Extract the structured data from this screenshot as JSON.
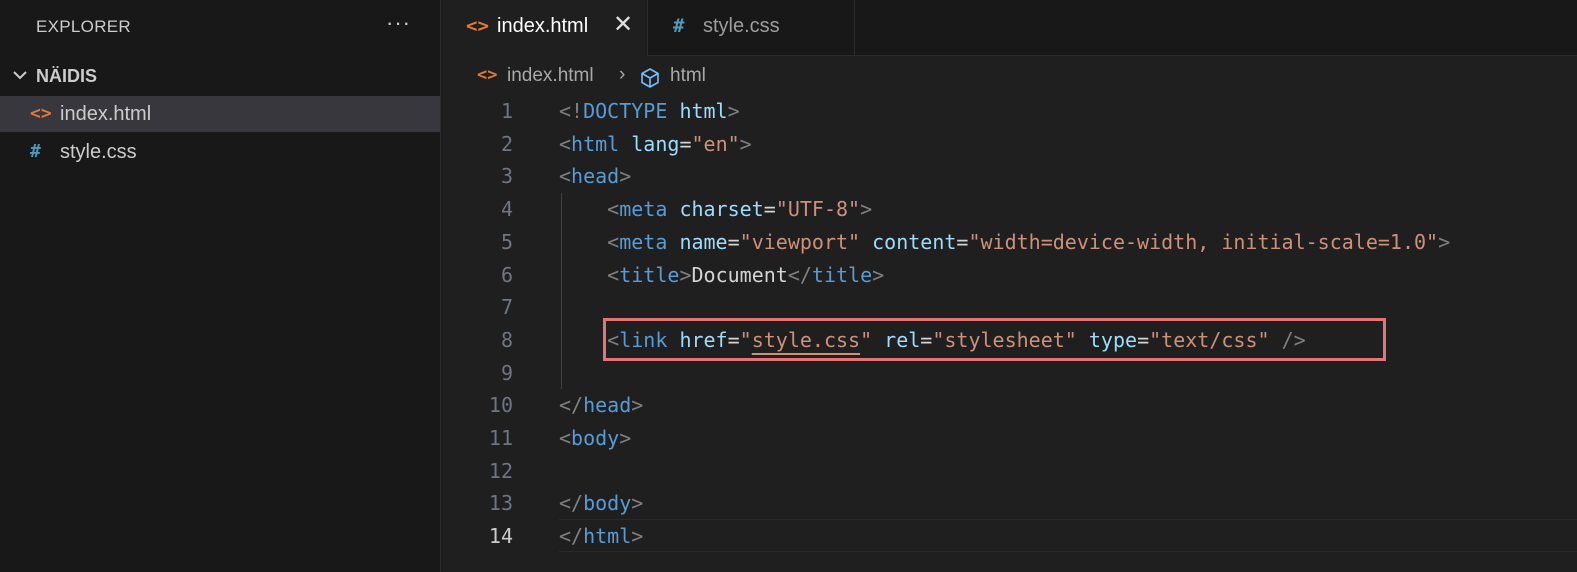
{
  "sidebar": {
    "title": "EXPLORER",
    "more": "···",
    "folder": "NÄIDIS",
    "files": [
      {
        "icon": "<>",
        "name": "index.html"
      },
      {
        "icon": "#",
        "name": "style.css"
      }
    ]
  },
  "tabs": [
    {
      "icon": "<>",
      "label": "index.html",
      "close": "✕"
    },
    {
      "icon": "#",
      "label": "style.css"
    }
  ],
  "breadcrumb": {
    "file_icon": "<>",
    "file": "index.html",
    "separator": "›",
    "symbol": "html"
  },
  "editor": {
    "current_line": 14,
    "lines": [
      {
        "n": "1",
        "tokens": [
          [
            "b",
            "<!"
          ],
          [
            "t",
            "DOCTYPE"
          ],
          [
            "x",
            " "
          ],
          [
            "a",
            "html"
          ],
          [
            "b",
            ">"
          ]
        ]
      },
      {
        "n": "2",
        "tokens": [
          [
            "b",
            "<"
          ],
          [
            "t",
            "html"
          ],
          [
            "x",
            " "
          ],
          [
            "a",
            "lang"
          ],
          [
            "x",
            "="
          ],
          [
            "s",
            "\"en\""
          ],
          [
            "b",
            ">"
          ]
        ]
      },
      {
        "n": "3",
        "tokens": [
          [
            "b",
            "<"
          ],
          [
            "t",
            "head"
          ],
          [
            "b",
            ">"
          ]
        ]
      },
      {
        "n": "4",
        "tokens": [
          [
            "x",
            "    "
          ],
          [
            "b",
            "<"
          ],
          [
            "t",
            "meta"
          ],
          [
            "x",
            " "
          ],
          [
            "a",
            "charset"
          ],
          [
            "x",
            "="
          ],
          [
            "s",
            "\"UTF-8\""
          ],
          [
            "b",
            ">"
          ]
        ]
      },
      {
        "n": "5",
        "tokens": [
          [
            "x",
            "    "
          ],
          [
            "b",
            "<"
          ],
          [
            "t",
            "meta"
          ],
          [
            "x",
            " "
          ],
          [
            "a",
            "name"
          ],
          [
            "x",
            "="
          ],
          [
            "s",
            "\"viewport\""
          ],
          [
            "x",
            " "
          ],
          [
            "a",
            "content"
          ],
          [
            "x",
            "="
          ],
          [
            "s",
            "\"width=device-width, initial-scale=1.0\""
          ],
          [
            "b",
            ">"
          ]
        ]
      },
      {
        "n": "6",
        "tokens": [
          [
            "x",
            "    "
          ],
          [
            "b",
            "<"
          ],
          [
            "t",
            "title"
          ],
          [
            "b",
            ">"
          ],
          [
            "x",
            "Document"
          ],
          [
            "b",
            "</"
          ],
          [
            "t",
            "title"
          ],
          [
            "b",
            ">"
          ]
        ]
      },
      {
        "n": "7",
        "tokens": []
      },
      {
        "n": "8",
        "tokens": [
          [
            "x",
            "    "
          ],
          [
            "b",
            "<"
          ],
          [
            "t",
            "link"
          ],
          [
            "x",
            " "
          ],
          [
            "a",
            "href"
          ],
          [
            "x",
            "="
          ],
          [
            "s",
            "\""
          ],
          [
            "l",
            "style.css"
          ],
          [
            "s",
            "\""
          ],
          [
            "x",
            " "
          ],
          [
            "a",
            "rel"
          ],
          [
            "x",
            "="
          ],
          [
            "s",
            "\"stylesheet\""
          ],
          [
            "x",
            " "
          ],
          [
            "a",
            "type"
          ],
          [
            "x",
            "="
          ],
          [
            "s",
            "\"text/css\""
          ],
          [
            "x",
            " "
          ],
          [
            "b",
            "/>"
          ]
        ]
      },
      {
        "n": "9",
        "tokens": []
      },
      {
        "n": "10",
        "tokens": [
          [
            "b",
            "</"
          ],
          [
            "t",
            "head"
          ],
          [
            "b",
            ">"
          ]
        ]
      },
      {
        "n": "11",
        "tokens": [
          [
            "b",
            "<"
          ],
          [
            "t",
            "body"
          ],
          [
            "b",
            ">"
          ]
        ]
      },
      {
        "n": "12",
        "tokens": []
      },
      {
        "n": "13",
        "tokens": [
          [
            "b",
            "</"
          ],
          [
            "t",
            "body"
          ],
          [
            "b",
            ">"
          ]
        ]
      },
      {
        "n": "14",
        "tokens": [
          [
            "b",
            "</"
          ],
          [
            "t",
            "html"
          ],
          [
            "b",
            ">"
          ]
        ]
      }
    ]
  },
  "colors": {
    "highlight_box": "#e67474",
    "html_icon": "#e37933",
    "css_icon": "#519aba"
  }
}
